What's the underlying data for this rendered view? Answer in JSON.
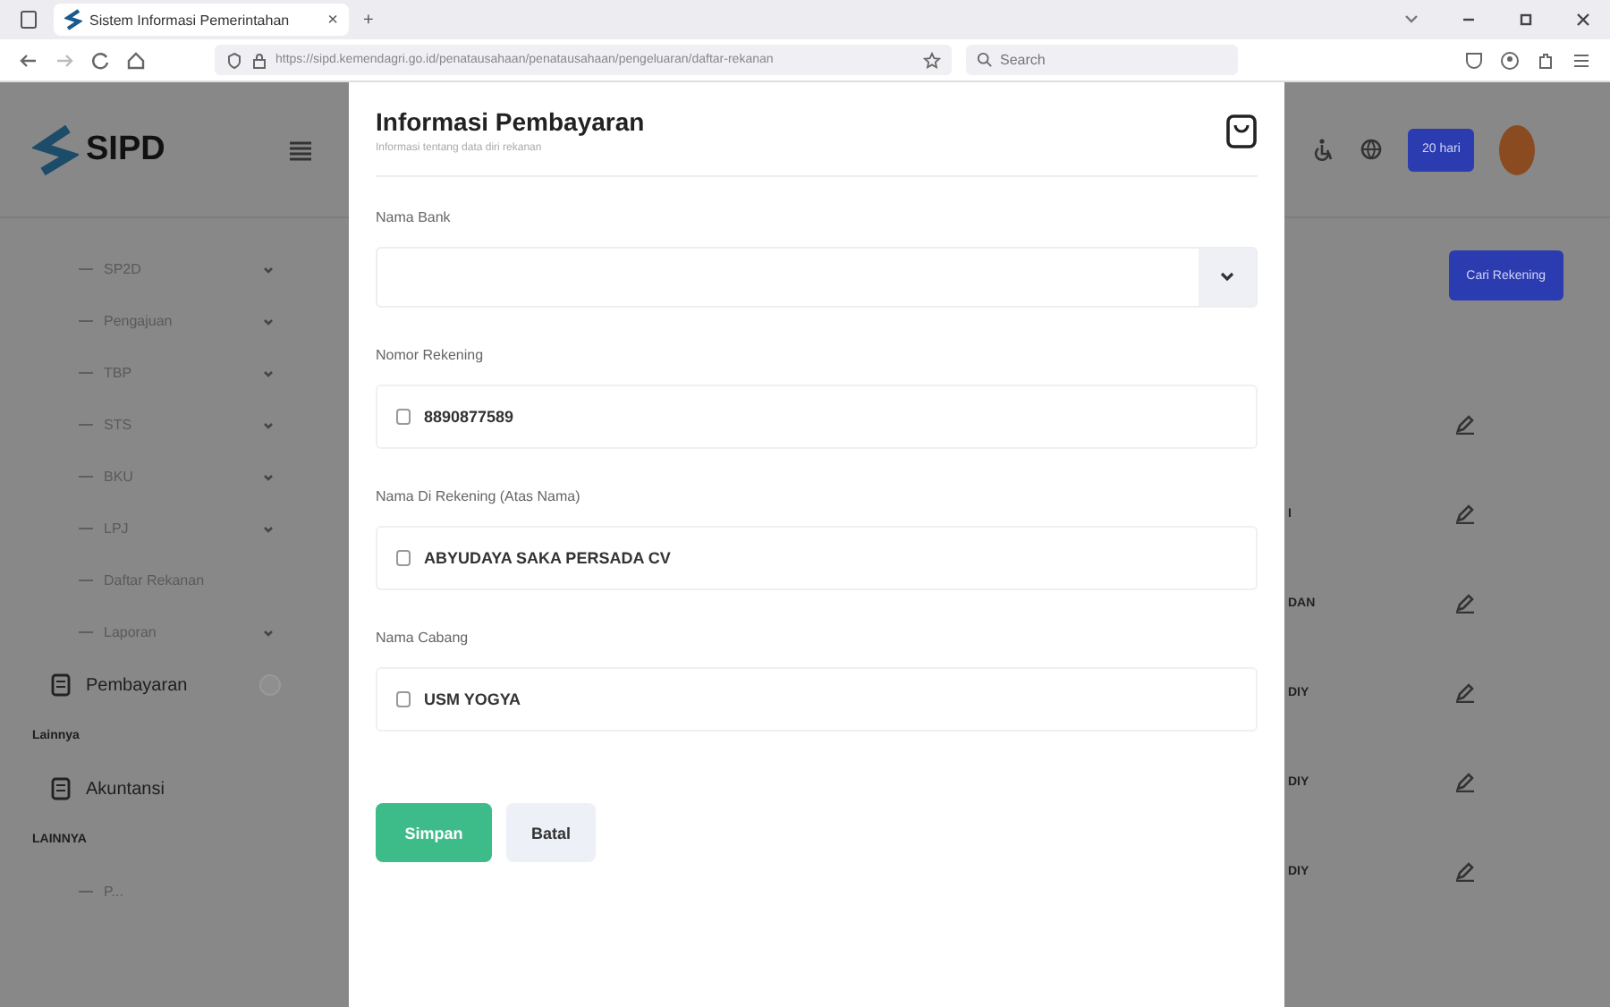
{
  "browser": {
    "tab_title": "Sistem Informasi Pemerintahan",
    "tab_close": "×",
    "new_tab": "+",
    "address": "https://sipd.kemendagri.go.id/penatausahaan/penatausahaan/pengeluaran/daftar-rekanan",
    "search_placeholder": "Search"
  },
  "sidebar": {
    "logo": "SIPD",
    "items": [
      {
        "kind": "sub",
        "label": "SP2D",
        "expandable": true
      },
      {
        "kind": "sub",
        "label": "Pengajuan",
        "expandable": true
      },
      {
        "kind": "sub",
        "label": "TBP",
        "expandable": true
      },
      {
        "kind": "sub",
        "label": "STS",
        "expandable": true
      },
      {
        "kind": "sub",
        "label": "BKU",
        "expandable": true
      },
      {
        "kind": "sub",
        "label": "LPJ",
        "expandable": true
      },
      {
        "kind": "sub",
        "label": "Daftar Rekanan",
        "expandable": false
      },
      {
        "kind": "sub",
        "label": "Laporan",
        "expandable": true
      },
      {
        "kind": "main",
        "label": "Pembayaran",
        "expandable": true
      },
      {
        "kind": "header",
        "label": "Lainnya"
      },
      {
        "kind": "main",
        "label": "Akuntansi",
        "expandable": false
      },
      {
        "kind": "header",
        "label": "LAINNYA"
      },
      {
        "kind": "sub",
        "label": "P...",
        "expandable": false
      }
    ]
  },
  "modal": {
    "title": "Informasi Pembayaran",
    "subtitle": "Informasi tentang data diri rekanan",
    "fields": [
      {
        "kind": "select",
        "label": "Nama Bank"
      },
      {
        "kind": "text",
        "label": "Nomor Rekening",
        "value": "8890877589"
      },
      {
        "kind": "text",
        "label": "Nama Di Rekening (Atas Nama)",
        "value": "ABYUDAYA SAKA PERSADA CV"
      },
      {
        "kind": "text",
        "label": "Nama Cabang",
        "value": "USM YOGYA"
      }
    ],
    "buttons": [
      {
        "kind": "primary",
        "label": "Simpan"
      },
      {
        "kind": "secondary",
        "label": "Batal"
      }
    ]
  },
  "header": {
    "badge": "20 hari"
  },
  "page": {
    "search_button": "Cari Rekening",
    "rows": [
      {},
      {
        "fragment": "I"
      },
      {
        "fragment": "DAN"
      },
      {
        "fragment": "DIY"
      },
      {
        "fragment": "DIY"
      },
      {
        "fragment": "DIY"
      }
    ]
  }
}
